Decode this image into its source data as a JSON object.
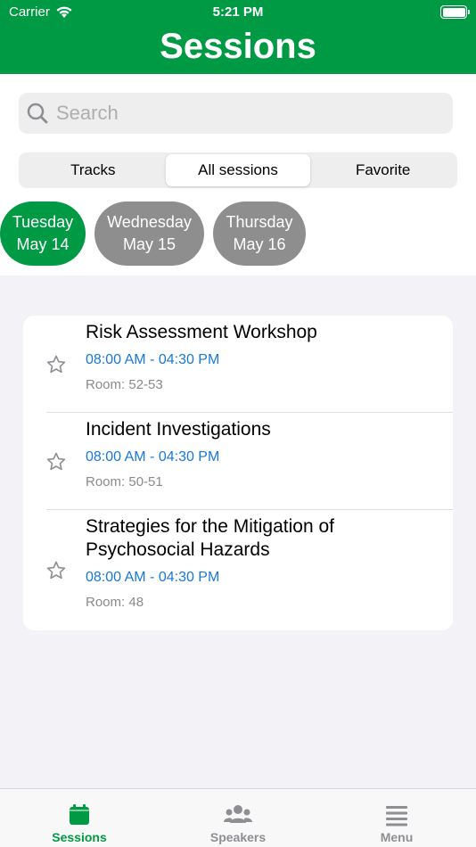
{
  "status_bar": {
    "carrier": "Carrier",
    "time": "5:21 PM"
  },
  "header": {
    "title": "Sessions"
  },
  "search": {
    "placeholder": "Search"
  },
  "segments": [
    {
      "label": "Tracks",
      "active": false
    },
    {
      "label": "All sessions",
      "active": true
    },
    {
      "label": "Favorite",
      "active": false
    }
  ],
  "days": [
    {
      "weekday": "Tuesday",
      "date": "May 14",
      "active": true
    },
    {
      "weekday": "Wednesday",
      "date": "May 15",
      "active": false
    },
    {
      "weekday": "Thursday",
      "date": "May 16",
      "active": false
    }
  ],
  "sessions": [
    {
      "title": "Risk Assessment Workshop",
      "time": "08:00 AM - 04:30 PM",
      "room": "Room: 52-53"
    },
    {
      "title": "Incident Investigations",
      "time": "08:00 AM - 04:30 PM",
      "room": "Room: 50-51"
    },
    {
      "title": "Strategies for the Mitigation of Psychosocial Hazards",
      "time": "08:00 AM - 04:30 PM",
      "room": "Room: 48"
    }
  ],
  "tabs": [
    {
      "label": "Sessions",
      "icon": "calendar-icon",
      "active": true
    },
    {
      "label": "Speakers",
      "icon": "people-icon",
      "active": false
    },
    {
      "label": "Menu",
      "icon": "menu-icon",
      "active": false
    }
  ],
  "colors": {
    "brand": "#009a44",
    "time_link": "#1778d9",
    "inactive_day": "#8e8e8e"
  }
}
